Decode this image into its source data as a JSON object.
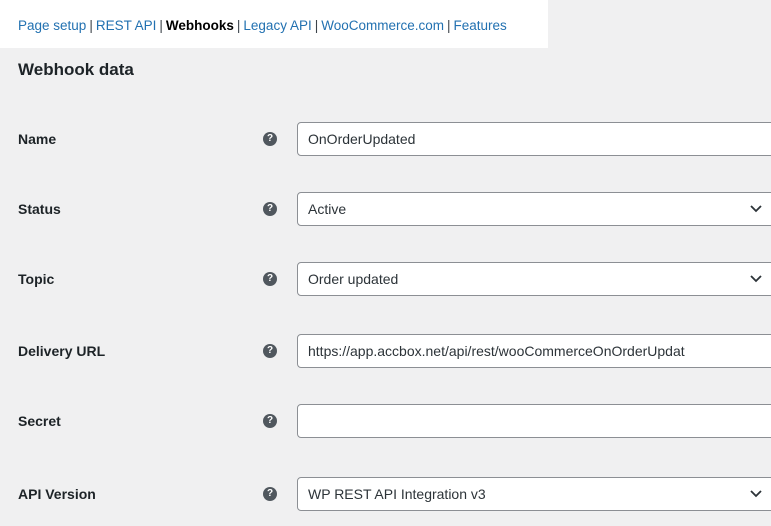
{
  "subnav": {
    "items": [
      {
        "label": "Page setup",
        "current": false
      },
      {
        "label": "REST API",
        "current": false
      },
      {
        "label": "Webhooks",
        "current": true
      },
      {
        "label": "Legacy API",
        "current": false
      },
      {
        "label": "WooCommerce.com",
        "current": false
      },
      {
        "label": "Features",
        "current": false
      }
    ],
    "separator": "|"
  },
  "section_title": "Webhook data",
  "help_glyph": "?",
  "fields": {
    "name": {
      "label": "Name",
      "value": "OnOrderUpdated"
    },
    "status": {
      "label": "Status",
      "value": "Active"
    },
    "topic": {
      "label": "Topic",
      "value": "Order updated"
    },
    "delivery_url": {
      "label": "Delivery URL",
      "value": "https://app.accbox.net/api/rest/wooCommerceOnOrderUpdat"
    },
    "secret": {
      "label": "Secret",
      "value": ""
    },
    "api_version": {
      "label": "API Version",
      "value": "WP REST API Integration v3"
    }
  },
  "colors": {
    "link": "#2271b1",
    "background": "#f0f0f1",
    "help_icon": "#50575e"
  }
}
